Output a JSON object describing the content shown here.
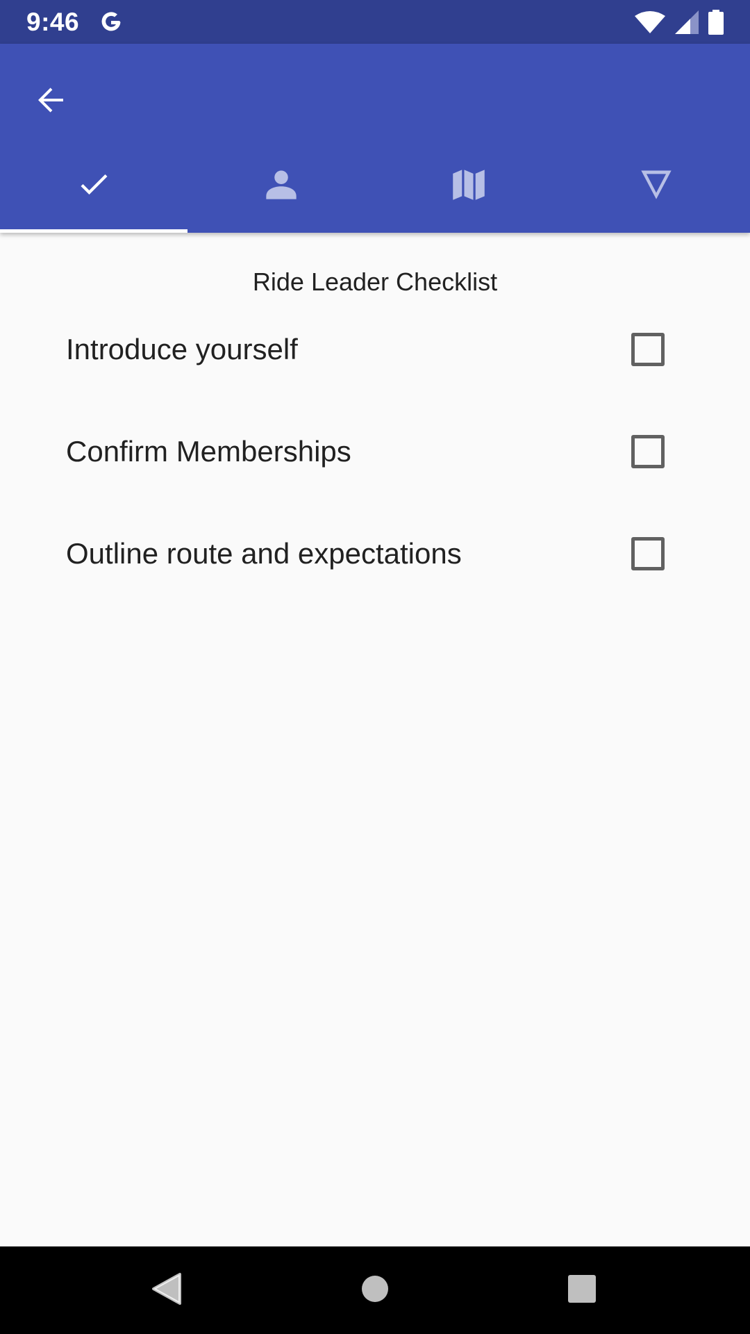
{
  "status_bar": {
    "time": "9:46",
    "left_icon": "google-g-icon",
    "right_icons": [
      "wifi-icon",
      "cell-signal-icon",
      "battery-icon"
    ]
  },
  "app_bar": {
    "back_icon": "arrow-back-icon",
    "tabs": [
      {
        "icon": "check-icon",
        "active": true
      },
      {
        "icon": "person-icon",
        "active": false
      },
      {
        "icon": "map-icon",
        "active": false
      },
      {
        "icon": "triangle-down-outline-icon",
        "active": false
      }
    ],
    "colors": {
      "primary": "#3f51b5",
      "status": "#303f8f",
      "inactive_icon": "#b7bfe6"
    }
  },
  "checklist": {
    "title": "Ride Leader Checklist",
    "items": [
      {
        "label": "Introduce yourself",
        "checked": false
      },
      {
        "label": "Confirm Memberships",
        "checked": false
      },
      {
        "label": "Outline route and expectations",
        "checked": false
      }
    ]
  },
  "nav_bar": {
    "buttons": [
      "back-triangle-icon",
      "home-circle-icon",
      "recents-square-icon"
    ]
  }
}
